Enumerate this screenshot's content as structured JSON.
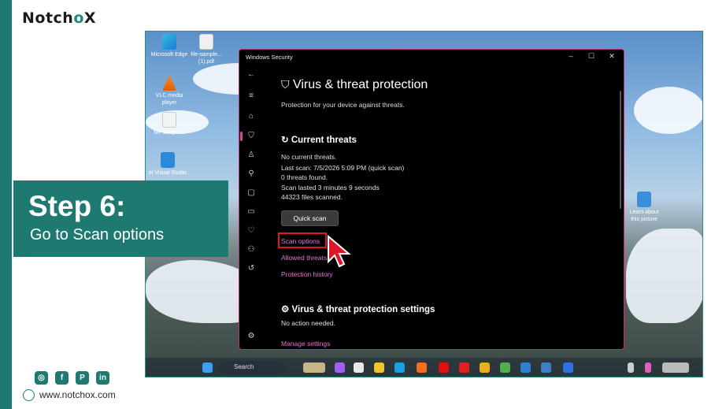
{
  "brand": {
    "logo_main": "Notch",
    "logo_o": "o",
    "logo_x": "X",
    "website": "www.notchox.com"
  },
  "step": {
    "title": "Step 6:",
    "subtitle": "Go to Scan options"
  },
  "desktop": {
    "icons": [
      {
        "label": "Microsoft Edge"
      },
      {
        "label": "file-sample... (1).pdf"
      },
      {
        "label": "VLC media player"
      },
      {
        "label": "file-sample..."
      },
      {
        "label": "el Visual Studio"
      },
      {
        "label": "Learn about this picture"
      }
    ]
  },
  "window": {
    "title": "Windows Security",
    "heading": "Virus & threat protection",
    "subheading": "Protection for your device against threats.",
    "current_threats": {
      "title": "Current threats",
      "lines": [
        "No current threats.",
        "Last scan: 7/5/2026 5:09 PM (quick scan)",
        "0 threats found.",
        "Scan lasted 3 minutes 9 seconds",
        "44323 files scanned."
      ],
      "quick_scan": "Quick scan",
      "links": [
        "Scan options",
        "Allowed threats",
        "Protection history"
      ]
    },
    "settings": {
      "title": "Virus & threat protection settings",
      "status": "No action needed.",
      "link": "Manage settings"
    }
  },
  "taskbar": {
    "search": "Search"
  },
  "colors": {
    "accent": "#1e7a70",
    "link": "#e870d8",
    "highlight": "#e0172a"
  }
}
